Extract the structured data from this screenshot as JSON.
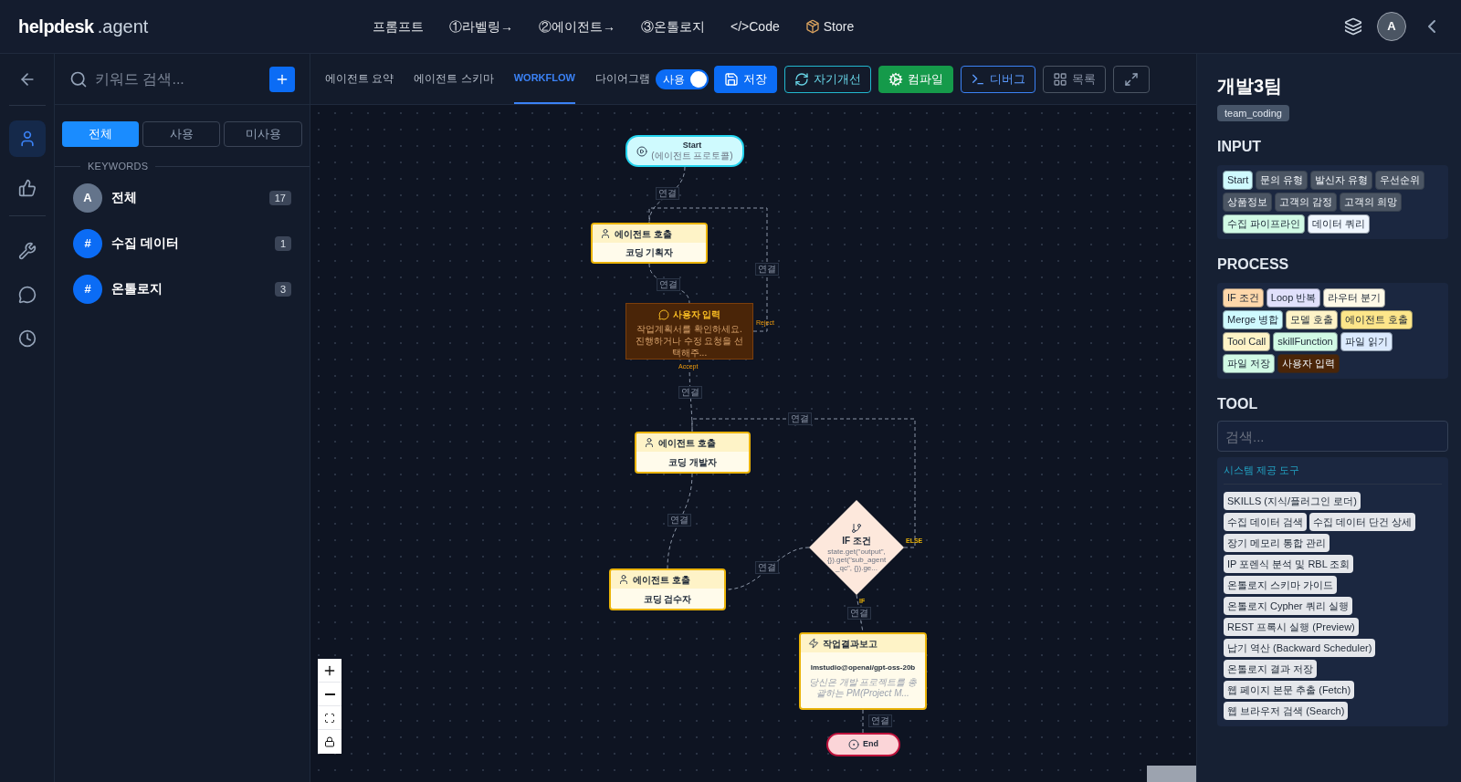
{
  "header": {
    "logo_bold": "helpdesk",
    "logo_light": ".agent",
    "avatar": "A",
    "nav": [
      {
        "label": "프롬프트",
        "kind": "text"
      },
      {
        "label": "①라벨링→",
        "kind": "text"
      },
      {
        "label": "②에이전트→",
        "kind": "text"
      },
      {
        "label": "③온톨로지",
        "kind": "text"
      },
      {
        "label": "</>Code",
        "kind": "text"
      },
      {
        "label": "Store",
        "kind": "package"
      }
    ]
  },
  "left_panel": {
    "search_placeholder": "키워드 검색...",
    "filters": [
      {
        "label": "전체",
        "selected": true
      },
      {
        "label": "사용",
        "selected": false
      },
      {
        "label": "미사용",
        "selected": false
      }
    ],
    "section": "KEYWORDS",
    "keywords": [
      {
        "avatar": "A",
        "name": "전체",
        "count": "17",
        "color": "#64748b"
      },
      {
        "avatar": "#",
        "name": "수집 데이터",
        "count": "1",
        "color": "#0b6cf5"
      },
      {
        "avatar": "#",
        "name": "온톨로지",
        "count": "3",
        "color": "#0b6cf5"
      }
    ]
  },
  "tabs": [
    {
      "label": "에이전트 요약",
      "selected": false
    },
    {
      "label": "에이전트 스키마",
      "selected": false
    },
    {
      "label": "WORKFLOW",
      "selected": true
    },
    {
      "label": "다이어그램",
      "selected": false
    }
  ],
  "toggle": {
    "label": "사용",
    "on": true
  },
  "actions": [
    {
      "label": "저장",
      "kind": "save"
    },
    {
      "label": "자기개선",
      "kind": "improve"
    },
    {
      "label": "컴파일",
      "kind": "compile"
    },
    {
      "label": "디버그",
      "kind": "debug"
    },
    {
      "label": "목록",
      "kind": "list"
    }
  ],
  "canvas": {
    "nodes": [
      {
        "kind": "start",
        "title": "Start",
        "subtitle": "(에이전트 프로토콜)"
      },
      {
        "kind": "agent",
        "title": "에이전트 호출",
        "body": "코딩 기획자"
      },
      {
        "kind": "user_input",
        "title": "사용자 입력",
        "body": "작업계획서를 확인하세요. 진행하거나 수정 요청을 선택해주...",
        "reject_label": "Reject",
        "accept_label": "Accept"
      },
      {
        "kind": "agent",
        "title": "에이전트 호출",
        "body": "코딩 개발자"
      },
      {
        "kind": "agent",
        "title": "에이전트 호출",
        "body": "코딩 검수자"
      },
      {
        "kind": "condition",
        "title": "IF 조건",
        "body": "state.get(\"output\", {}).get(\"sub_agent_qc\", {}).ge...",
        "else_label": "ELSE",
        "if_label": "IF"
      },
      {
        "kind": "report",
        "title": "작업결과보고",
        "model": "lmstudio@openai/gpt-oss-20b",
        "body": "당신은 개발 프로젝트를 총괄하는 PM(Project M..."
      },
      {
        "kind": "end",
        "title": "End"
      }
    ],
    "edges": [
      {
        "label": "연결"
      },
      {
        "label": "연결"
      },
      {
        "label": "연결"
      },
      {
        "label": "연결"
      },
      {
        "label": "연결"
      },
      {
        "label": "연결"
      },
      {
        "label": "연결"
      },
      {
        "label": "연결"
      },
      {
        "label": "연결"
      }
    ]
  },
  "right_panel": {
    "title": "개발3팀",
    "badge": "team_coding",
    "sections": [
      {
        "title": "INPUT",
        "tags": [
          {
            "label": "Start",
            "color": "#cffafe"
          },
          {
            "label": "문의 유형",
            "color": "#4b5563"
          },
          {
            "label": "발신자 유형",
            "color": "#4b5563"
          },
          {
            "label": "우선순위",
            "color": "#4b5563"
          },
          {
            "label": "상품정보",
            "color": "#4b5563"
          },
          {
            "label": "고객의 감정",
            "color": "#4b5563"
          },
          {
            "label": "고객의 희망",
            "color": "#4b5563"
          },
          {
            "label": "수집 파이프라인",
            "color": "#d1fae5"
          },
          {
            "label": "데이터 쿼리",
            "color": "#eff6ff"
          }
        ]
      },
      {
        "title": "PROCESS",
        "tags": [
          {
            "label": "IF 조건",
            "color": "#fed7aa"
          },
          {
            "label": "Loop 반복",
            "color": "#e0e0fb"
          },
          {
            "label": "라우터 분기",
            "color": "#fef9e7"
          },
          {
            "label": "Merge 병합",
            "color": "#cffafe"
          },
          {
            "label": "모델 호출",
            "color": "#fef3c7"
          },
          {
            "label": "에이전트 호출",
            "color": "#fde68a"
          },
          {
            "label": "Tool Call",
            "color": "#fef3c7"
          },
          {
            "label": "skillFunction",
            "color": "#d1fae5"
          },
          {
            "label": "파일 읽기",
            "color": "#dbeafe"
          },
          {
            "label": "파일 저장",
            "color": "#d1fae5"
          },
          {
            "label": "사용자 입력",
            "color": "#4a2508"
          }
        ]
      }
    ],
    "tool": {
      "title": "TOOL",
      "search_placeholder": "검색...",
      "group": "시스템 제공 도구",
      "tools": [
        "SKILLS (지식/플러그인 로더)",
        "수집 데이터 검색",
        "수집 데이터 단건 상세",
        "장기 메모리 통합 관리",
        "IP 포렌식 분석 및 RBL 조회",
        "온톨로지 스키마 가이드",
        "온톨로지 Cypher 쿼리 실행",
        "REST 프록시 실행 (Preview)",
        "납기 역산 (Backward Scheduler)",
        "온톨로지 결과 저장",
        "웹 페이지 본문 추출 (Fetch)",
        "웹 브라우저 검색 (Search)"
      ]
    }
  }
}
